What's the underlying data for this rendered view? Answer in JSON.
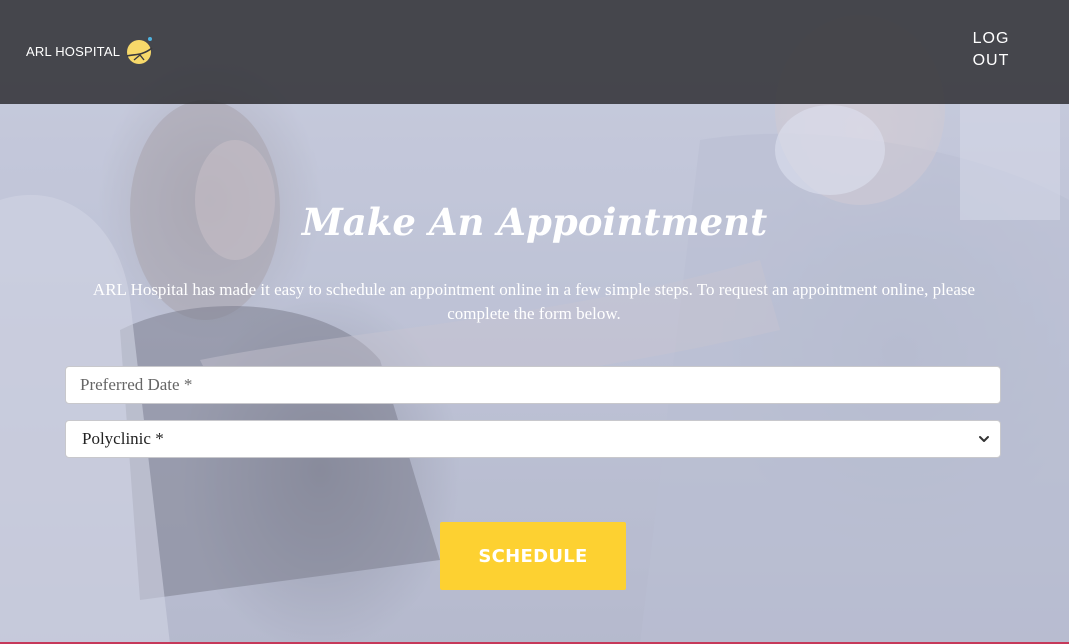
{
  "header": {
    "logo_text": "ARL HOSPITAL",
    "logout_line1": "LOG",
    "logout_line2": "OUT"
  },
  "main": {
    "title": "Make An Appointment",
    "description": "ARL Hospital has made it easy to schedule an appointment online in a few simple steps. To request an appointment online, please complete the form below."
  },
  "form": {
    "date_placeholder": "Preferred Date *",
    "polyclinic_selected": "Polyclinic *",
    "submit_label": "SCHEDULE"
  },
  "colors": {
    "accent": "#fdd131",
    "header_bg": "#28282c",
    "bottom_line": "#c6395a"
  },
  "icons": {
    "logo": "moon-logo-icon",
    "select_arrow": "chevron-down-icon"
  }
}
